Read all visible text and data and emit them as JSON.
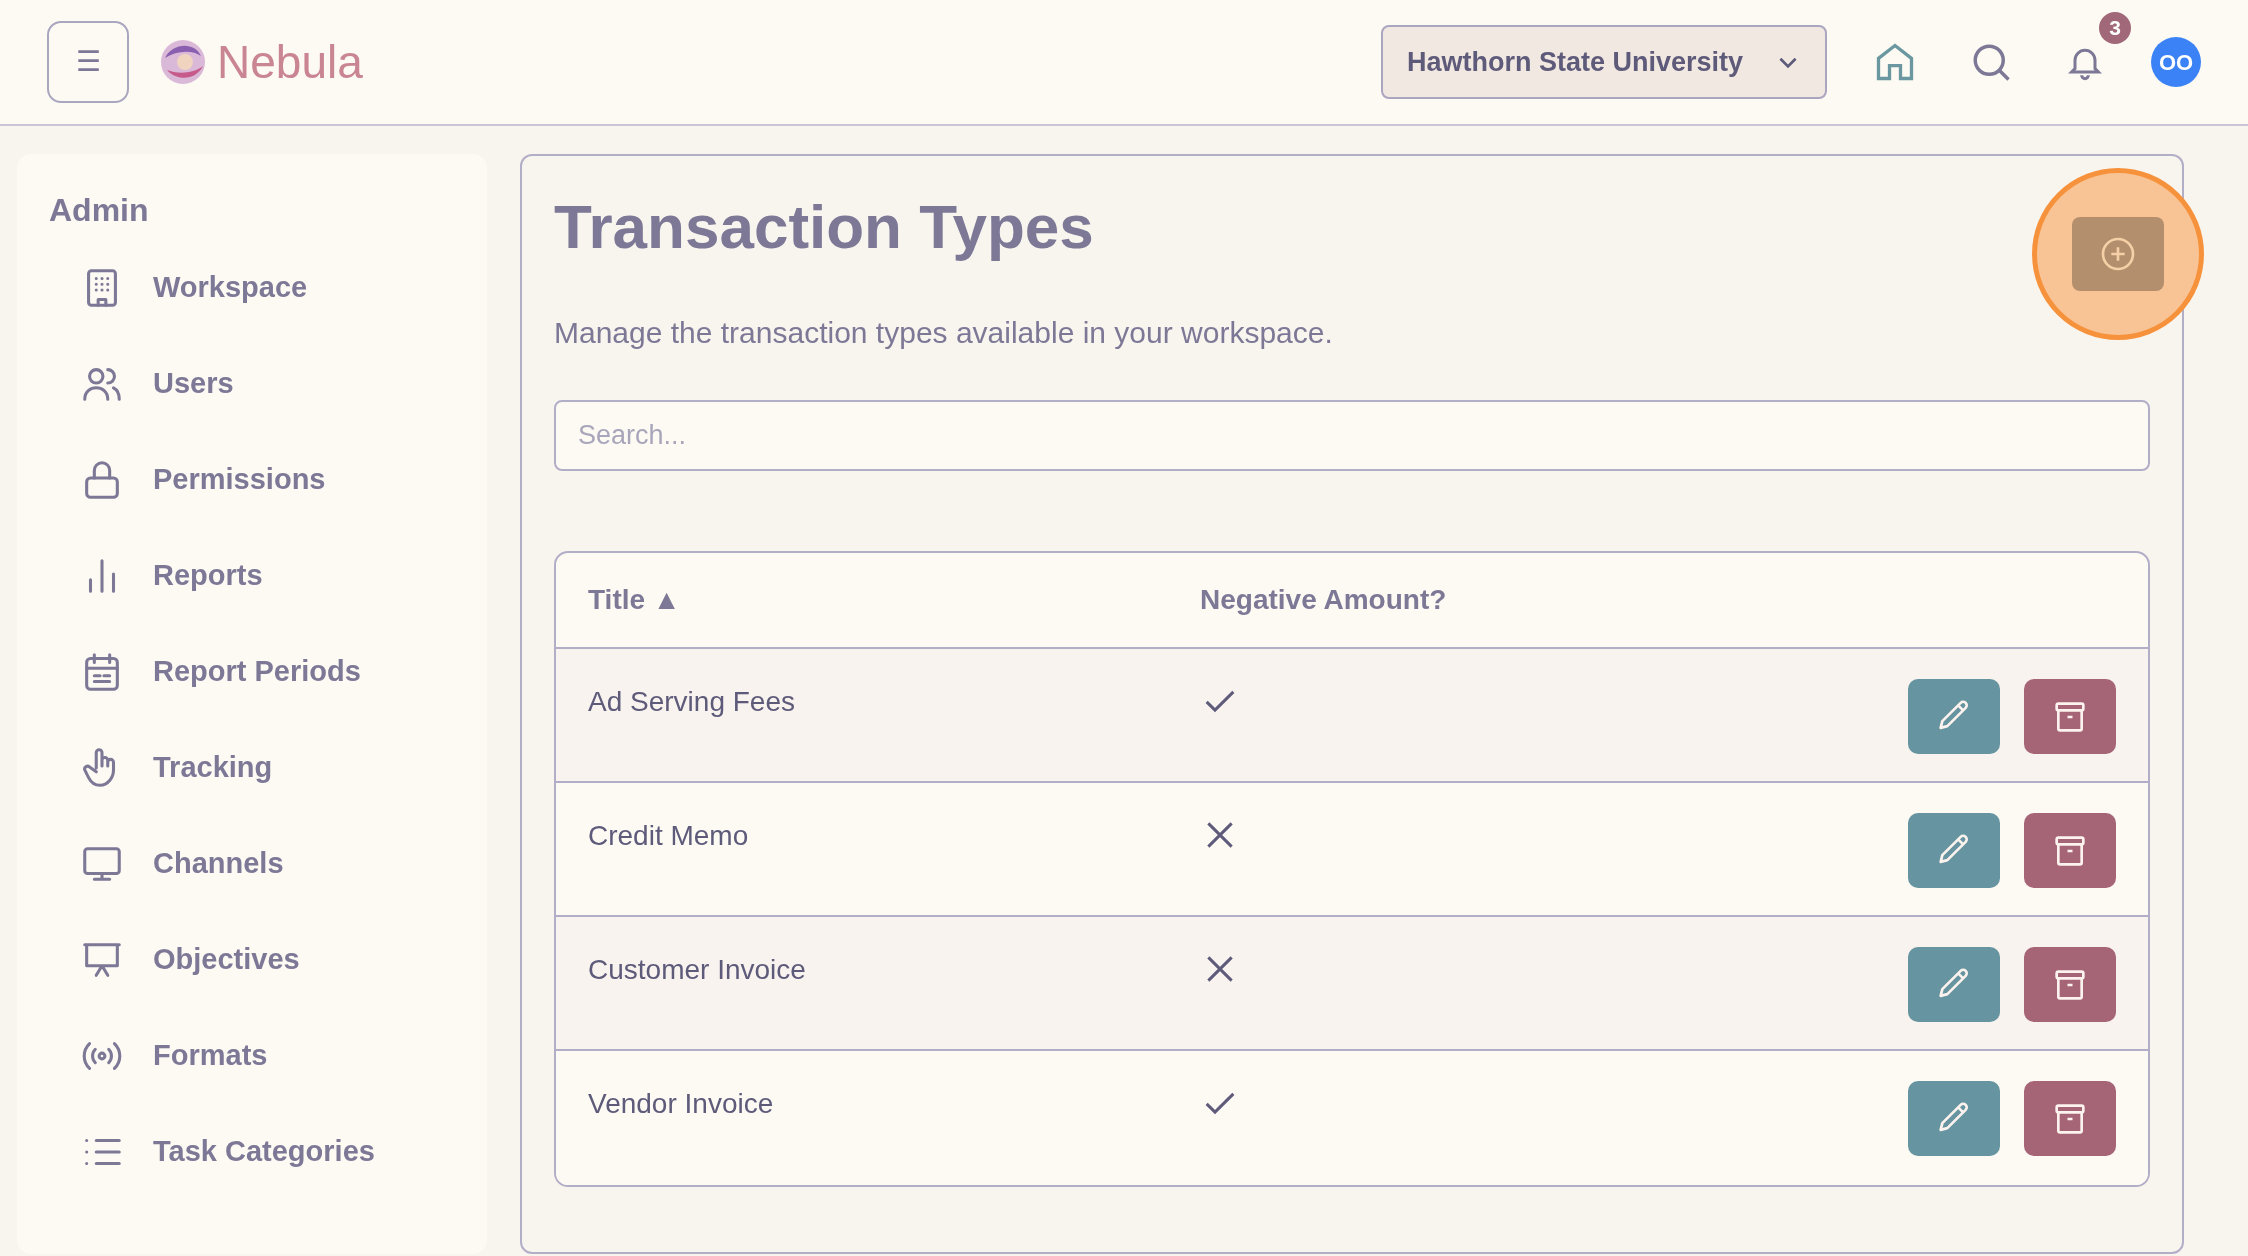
{
  "header": {
    "menu_icon": "☰",
    "brand": "Nebula",
    "workspace": "Hawthorn State University",
    "notifications": "3",
    "avatar": "OO"
  },
  "sidebar": {
    "title": "Admin",
    "items": [
      {
        "label": "Workspace"
      },
      {
        "label": "Users"
      },
      {
        "label": "Permissions"
      },
      {
        "label": "Reports"
      },
      {
        "label": "Report Periods"
      },
      {
        "label": "Tracking"
      },
      {
        "label": "Channels"
      },
      {
        "label": "Objectives"
      },
      {
        "label": "Formats"
      },
      {
        "label": "Task Categories"
      }
    ]
  },
  "page": {
    "title": "Transaction Types",
    "description": "Manage the transaction types available in your workspace.",
    "add_highlighted": true,
    "search": {
      "placeholder": "Search..."
    },
    "table": {
      "columns": [
        {
          "label": "Title",
          "sort": "▲"
        },
        {
          "label": "Negative Amount?"
        }
      ],
      "rows": [
        {
          "title": "Ad Serving Fees",
          "negative": true
        },
        {
          "title": "Credit Memo",
          "negative": false
        },
        {
          "title": "Customer Invoice",
          "negative": false
        },
        {
          "title": "Vendor Invoice",
          "negative": true
        }
      ]
    }
  }
}
